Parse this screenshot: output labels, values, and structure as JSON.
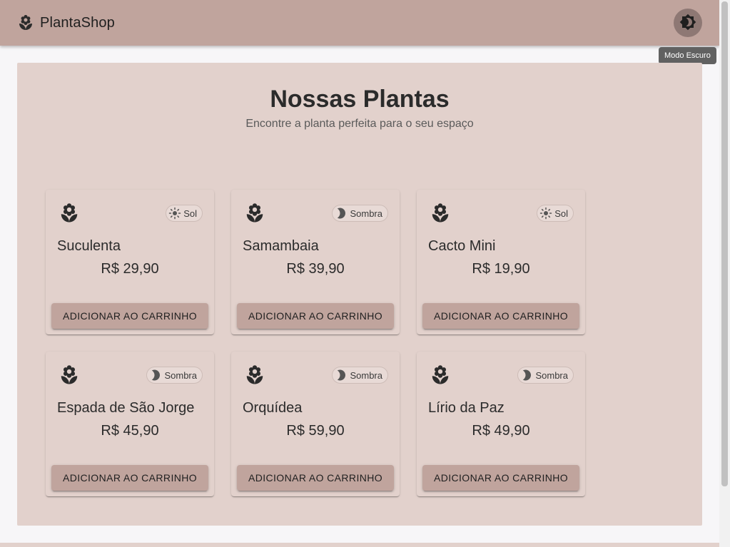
{
  "app": {
    "title": "PlantaShop",
    "theme_tooltip": "Modo Escuro",
    "theme_toggle_icon": "brightness-icon"
  },
  "main": {
    "title": "Nossas Plantas",
    "subtitle": "Encontre a planta perfeita para o seu espaço"
  },
  "products": [
    {
      "name": "Suculenta",
      "price": "R$ 29,90",
      "light": "Sol",
      "light_icon": "sun-icon",
      "button": "ADICIONAR AO CARRINHO"
    },
    {
      "name": "Samambaia",
      "price": "R$ 39,90",
      "light": "Sombra",
      "light_icon": "moon-icon",
      "button": "ADICIONAR AO CARRINHO"
    },
    {
      "name": "Cacto Mini",
      "price": "R$ 19,90",
      "light": "Sol",
      "light_icon": "sun-icon",
      "button": "ADICIONAR AO CARRINHO"
    },
    {
      "name": "Espada de São Jorge",
      "price": "R$ 45,90",
      "light": "Sombra",
      "light_icon": "moon-icon",
      "button": "ADICIONAR AO CARRINHO"
    },
    {
      "name": "Orquídea",
      "price": "R$ 59,90",
      "light": "Sombra",
      "light_icon": "moon-icon",
      "button": "ADICIONAR AO CARRINHO"
    },
    {
      "name": "Lírio da Paz",
      "price": "R$ 49,90",
      "light": "Sombra",
      "light_icon": "moon-icon",
      "button": "ADICIONAR AO CARRINHO"
    }
  ],
  "colors": {
    "appbar": "#c0a49d",
    "surface": "#e2d1cc",
    "button": "#c0a49d",
    "background": "#f7f6f8"
  }
}
